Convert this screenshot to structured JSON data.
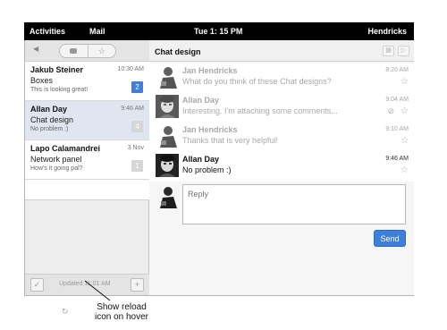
{
  "topbar": {
    "activities": "Activities",
    "app": "Mail",
    "clock": "Tue 1: 15 PM",
    "user": "Hendricks"
  },
  "sidebar": {
    "back_icon": "back-arrow-icon",
    "segments": [
      "chat-bubble-icon",
      "star-icon"
    ],
    "conversations": [
      {
        "name": "Jakub Steiner",
        "time": "10:30 AM",
        "subject": "Boxes",
        "snippet": "This is looking great!",
        "count": "2",
        "badge_style": "blue"
      },
      {
        "name": "Allan Day",
        "time": "9:46 AM",
        "subject": "Chat design",
        "snippet": "No problem :)",
        "count": "4",
        "badge_style": "light",
        "selected": true
      },
      {
        "name": "Lapo Calamandrei",
        "time": "3 Nov",
        "subject": "Network panel",
        "snippet": "How's it going pal?",
        "count": "1",
        "badge_style": "light"
      }
    ],
    "footer": {
      "updated": "Updated 11:01 AM",
      "check_icon": "check-icon",
      "plus_icon": "plus-icon"
    }
  },
  "thread": {
    "title": "Chat design",
    "messages": [
      {
        "sender": "Jan Hendricks",
        "text": "What do you think of these Chat designs?",
        "time": "8:20 AM",
        "faded": true,
        "attachment": false
      },
      {
        "sender": "Allan Day",
        "text": "Interesting. I'm attaching some comments...",
        "time": "9:04 AM",
        "faded": true,
        "attachment": true
      },
      {
        "sender": "Jan Hendricks",
        "text": "Thanks that is very helpful!",
        "time": "9:10 AM",
        "faded": true,
        "attachment": false
      },
      {
        "sender": "Allan Day",
        "text": "No problem :)",
        "time": "9:46 AM",
        "faded": false,
        "attachment": false
      }
    ],
    "reply_placeholder": "Reply",
    "send_label": "Send"
  },
  "annotation": {
    "line1": "Show reload",
    "line2": "icon on hover",
    "icon": "reload-icon"
  },
  "colors": {
    "accent": "#3e7fdc",
    "topbar": "#000000",
    "selected_row": "#dfe6f0"
  }
}
